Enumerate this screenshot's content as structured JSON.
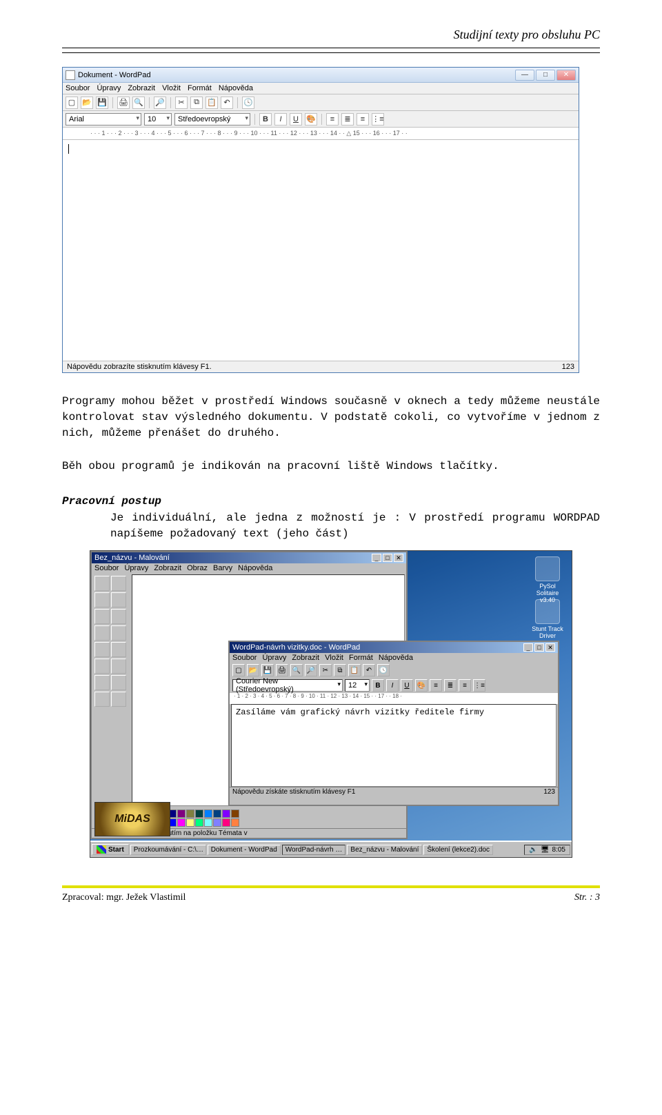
{
  "doc": {
    "header_right": "Studijní texty pro obsluhu  PC",
    "para1": "Programy mohou běžet v prostředí Windows současně v oknech a tedy můžeme neustále kontrolovat stav výsledného dokumentu. V podstatě cokoli, co vytvoříme v jednom z nich, můžeme přenášet do druhého.",
    "para2": "Běh obou programů je indikován na pracovní liště Windows tlačítky.",
    "postup_heading": "Pracovní postup",
    "postup_body": "Je individuální, ale jedna z možností je : V prostředí programu WORDPAD napíšeme požadovaný text (jeho část)",
    "footer_left": "Zpracoval: mgr. Ježek Vlastimil",
    "footer_right": "Str. : 3"
  },
  "wordpad1": {
    "title": "Dokument - WordPad",
    "menu": [
      "Soubor",
      "Úpravy",
      "Zobrazit",
      "Vložit",
      "Formát",
      "Nápověda"
    ],
    "font": "Arial",
    "size": "10",
    "charset": "Středoevropský",
    "ruler": "· · · 1 · · · 2 · · · 3 · · · 4 · · · 5 · · · 6 · · · 7 · · · 8 · · · 9 · · · 10 · · · 11 · · · 12 · · · 13 · · · 14 · · △ 15 · · · 16 · · · 17 · ·",
    "status_left": "Nápovědu zobrazíte stisknutím klávesy F1.",
    "status_right": "123"
  },
  "paint": {
    "title": "Bez_názvu - Malování",
    "menu": [
      "Soubor",
      "Úpravy",
      "Zobrazit",
      "Obraz",
      "Barvy",
      "Nápověda"
    ],
    "status": "Nápovědu získáte klepnutím na položku Témata v",
    "palette": [
      "#000",
      "#808080",
      "#800000",
      "#808000",
      "#008000",
      "#008080",
      "#000080",
      "#800080",
      "#808040",
      "#004040",
      "#0080ff",
      "#004080",
      "#8000ff",
      "#804000",
      "#fff",
      "#c0c0c0",
      "#f00",
      "#ff0",
      "#0f0",
      "#0ff",
      "#00f",
      "#f0f",
      "#ffff80",
      "#00ff80",
      "#80ffff",
      "#8080ff",
      "#ff0080",
      "#ff8040"
    ]
  },
  "wordpad2": {
    "title": "WordPad-návrh vizitky.doc - WordPad",
    "menu": [
      "Soubor",
      "Úpravy",
      "Zobrazit",
      "Vložit",
      "Formát",
      "Nápověda"
    ],
    "font": "Courier New (Středoevropský)",
    "size": "12",
    "ruler": "· 1 · 2 · 3 · 4 · 5 · 6 · 7 · 8 · 9 · 10 · 11 · 12 · 13 · 14 · 15 · · 17 · · 18 ·",
    "body_text": "Zasíláme vám grafický návrh vizitky ředitele firmy",
    "status_left": "Nápovědu získáte stisknutím klávesy F1",
    "status_right": "123"
  },
  "desktop_icons": [
    {
      "label": "PySol Solitaire v3.40"
    },
    {
      "label": "Stunt Track Driver"
    }
  ],
  "midas_label": "MiDAS",
  "taskbar": {
    "start": "Start",
    "tasks": [
      "Prozkoumávání - C:\\…",
      "Dokument - WordPad",
      "WordPad-návrh …",
      "Bez_názvu - Malování",
      "Školení (lekce2).doc"
    ],
    "clock": "8:05"
  }
}
